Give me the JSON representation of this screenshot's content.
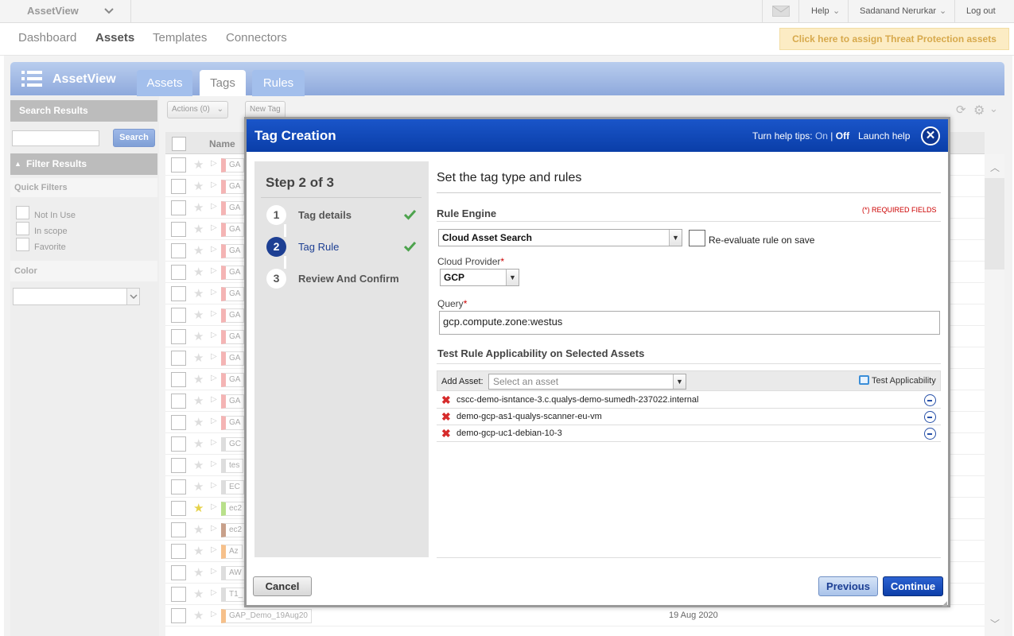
{
  "topbar": {
    "app_name": "AssetView",
    "help": "Help",
    "user": "Sadanand Nerurkar",
    "logout": "Log out"
  },
  "nav": {
    "items": [
      "Dashboard",
      "Assets",
      "Templates",
      "Connectors"
    ],
    "active": "Assets",
    "threat_banner": "Click here to assign Threat Protection assets"
  },
  "assetview": {
    "title": "AssetView",
    "tabs": [
      "Assets",
      "Tags",
      "Rules"
    ],
    "active_tab": "Tags"
  },
  "left": {
    "search_results": "Search Results",
    "search_button": "Search",
    "filter_results": "Filter Results",
    "quick_filters": "Quick Filters",
    "filters": [
      "Not In Use",
      "In scope",
      "Favorite"
    ],
    "color": "Color"
  },
  "toolbar": {
    "actions": "Actions (0)",
    "new_tag": "New Tag"
  },
  "table": {
    "name_header": "Name",
    "rows": [
      {
        "tag": "GA",
        "color": "#f4b4b4"
      },
      {
        "tag": "GA",
        "color": "#f4b4b4"
      },
      {
        "tag": "GA",
        "color": "#f4b4b4"
      },
      {
        "tag": "GA",
        "color": "#f4b4b4"
      },
      {
        "tag": "GA",
        "color": "#f4b4b4"
      },
      {
        "tag": "GA",
        "color": "#f4b4b4"
      },
      {
        "tag": "GA",
        "color": "#f4b4b4"
      },
      {
        "tag": "GA",
        "color": "#f4b4b4"
      },
      {
        "tag": "GA",
        "color": "#f4b4b4"
      },
      {
        "tag": "GA",
        "color": "#f4b4b4"
      },
      {
        "tag": "GA",
        "color": "#f4b4b4"
      },
      {
        "tag": "GA",
        "color": "#f4b4b4"
      },
      {
        "tag": "GA",
        "color": "#f4b4b4"
      },
      {
        "tag": "GC",
        "color": "#dddddd"
      },
      {
        "tag": "tes",
        "color": "#dddddd"
      },
      {
        "tag": "EC",
        "color": "#dddddd"
      },
      {
        "tag": "ec2",
        "color": "#b8e08a",
        "fav": true
      },
      {
        "tag": "ec2",
        "color": "#c8a08a"
      },
      {
        "tag": "Az",
        "color": "#f6c08a"
      },
      {
        "tag": "AW",
        "color": "#dddddd"
      },
      {
        "tag": "T1_",
        "color": "#dddddd"
      },
      {
        "tag": "GAP_Demo_19Aug20",
        "color": "#f6c08a",
        "date": "19 Aug 2020"
      }
    ]
  },
  "modal": {
    "title": "Tag Creation",
    "help_tips": "Turn help tips:",
    "help_on": "On",
    "help_sep": "|",
    "help_off": "Off",
    "launch_help": "Launch help",
    "close": "✕",
    "step_title": "Step 2 of 3",
    "steps": [
      {
        "num": "1",
        "label": "Tag details",
        "done": true
      },
      {
        "num": "2",
        "label": "Tag Rule",
        "done": true,
        "active": true
      },
      {
        "num": "3",
        "label": "Review And Confirm",
        "done": false
      }
    ],
    "section_title": "Set the tag type and rules",
    "rule_engine_label": "Rule Engine",
    "required_note": "(*) REQUIRED FIELDS",
    "rule_engine_value": "Cloud Asset Search",
    "reevaluate_label": "Re-evaluate rule on save",
    "cloud_provider_label": "Cloud Provider",
    "cloud_provider_value": "GCP",
    "query_label": "Query",
    "query_value": "gcp.compute.zone:westus",
    "test_title": "Test Rule Applicability on Selected Assets",
    "add_asset_label": "Add Asset:",
    "add_asset_placeholder": "Select an asset",
    "test_applicability": "Test Applicability",
    "assets": [
      "cscc-demo-isntance-3.c.qualys-demo-sumedh-237022.internal",
      "demo-gcp-as1-qualys-scanner-eu-vm",
      "demo-gcp-uc1-debian-10-3"
    ],
    "cancel": "Cancel",
    "previous": "Previous",
    "continue": "Continue"
  }
}
